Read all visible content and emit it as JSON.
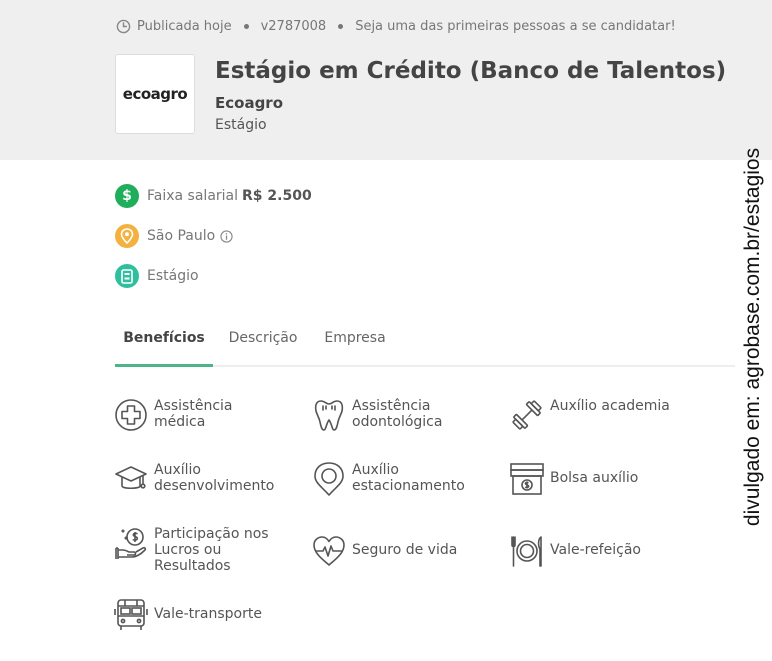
{
  "header": {
    "meta": {
      "published": "Publicada hoje",
      "code": "v2787008",
      "cta": "Seja uma das primeiras pessoas a se candidatar!"
    },
    "logo_text": "ecoagro",
    "title": "Estágio em Crédito (Banco de Talentos)",
    "company": "Ecoagro",
    "type": "Estágio"
  },
  "info": {
    "salary_label": "Faixa salarial",
    "salary_value": "R$ 2.500",
    "location": "São Paulo",
    "contract": "Estágio"
  },
  "tabs": [
    "Benefícios",
    "Descrição",
    "Empresa"
  ],
  "benefits": [
    {
      "icon": "medical-cross-icon",
      "label": "Assistência médica"
    },
    {
      "icon": "tooth-icon",
      "label": "Assistência odontológica"
    },
    {
      "icon": "dumbbell-icon",
      "label": "Auxílio academia"
    },
    {
      "icon": "graduation-cap-icon",
      "label": "Auxílio desenvolvimento"
    },
    {
      "icon": "parking-pin-icon",
      "label": "Auxílio estacionamento"
    },
    {
      "icon": "money-bills-icon",
      "label": "Bolsa auxílio"
    },
    {
      "icon": "hand-coins-icon",
      "label": "Participação nos Lucros ou Resultados"
    },
    {
      "icon": "heart-pulse-icon",
      "label": "Seguro de vida"
    },
    {
      "icon": "plate-cutlery-icon",
      "label": "Vale-refeição"
    },
    {
      "icon": "bus-icon",
      "label": "Vale-transporte"
    }
  ],
  "watermark": "divulgado em: agrobase.com.br/estagios",
  "colors": {
    "accent_green": "#4fb38a",
    "salary_badge": "#1fae5b",
    "location_badge": "#f3b13f",
    "contract_badge": "#2fbf9e",
    "header_bg": "#efefef"
  }
}
